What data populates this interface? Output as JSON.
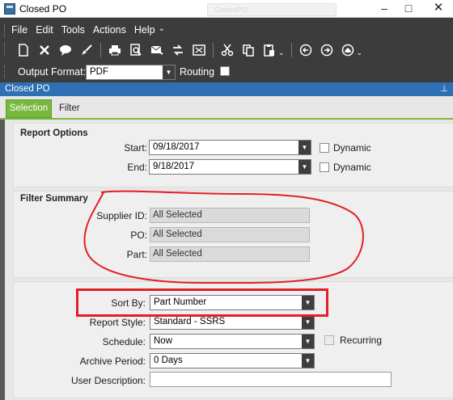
{
  "window": {
    "title": "Closed PO",
    "ghost_tab": "ClosedPO",
    "controls": {
      "minimize": "–",
      "maximize": "□",
      "close": "✕"
    }
  },
  "menu": {
    "items": [
      "File",
      "Edit",
      "Tools",
      "Actions",
      "Help"
    ]
  },
  "toolbar": {
    "icons": [
      "new-icon",
      "delete-icon",
      "comment-icon",
      "clear-icon",
      "print-icon",
      "print-preview-icon",
      "send-icon",
      "transfer-icon",
      "export-icon",
      "cut-icon",
      "copy-icon",
      "paste-icon",
      "back-icon",
      "forward-icon",
      "home-icon"
    ]
  },
  "output_format": {
    "label": "Output Format:",
    "value": "PDF",
    "routing_label": "Routing",
    "routing_checked": false
  },
  "panel": {
    "title": "Closed PO",
    "tabs": [
      "Selection",
      "Filter"
    ],
    "active_tab": "Selection"
  },
  "report_options": {
    "title": "Report Options",
    "start_label": "Start:",
    "start_value": "09/18/2017",
    "end_label": "End:",
    "end_value": "9/18/2017",
    "dynamic_label": "Dynamic"
  },
  "filter_summary": {
    "title": "Filter Summary",
    "rows": [
      {
        "label": "Supplier ID:",
        "value": "All Selected"
      },
      {
        "label": "PO:",
        "value": "All Selected"
      },
      {
        "label": "Part:",
        "value": "All Selected"
      }
    ]
  },
  "settings": {
    "sort_by_label": "Sort By:",
    "sort_by_value": "Part Number",
    "report_style_label": "Report Style:",
    "report_style_value": "Standard - SSRS",
    "schedule_label": "Schedule:",
    "schedule_value": "Now",
    "recurring_label": "Recurring",
    "archive_label": "Archive Period:",
    "archive_value": "0 Days",
    "user_desc_label": "User Description:",
    "user_desc_value": ""
  },
  "colors": {
    "accent_green": "#79b83e",
    "panel_blue": "#2f6fb3",
    "annotation_red": "#e21f26"
  }
}
